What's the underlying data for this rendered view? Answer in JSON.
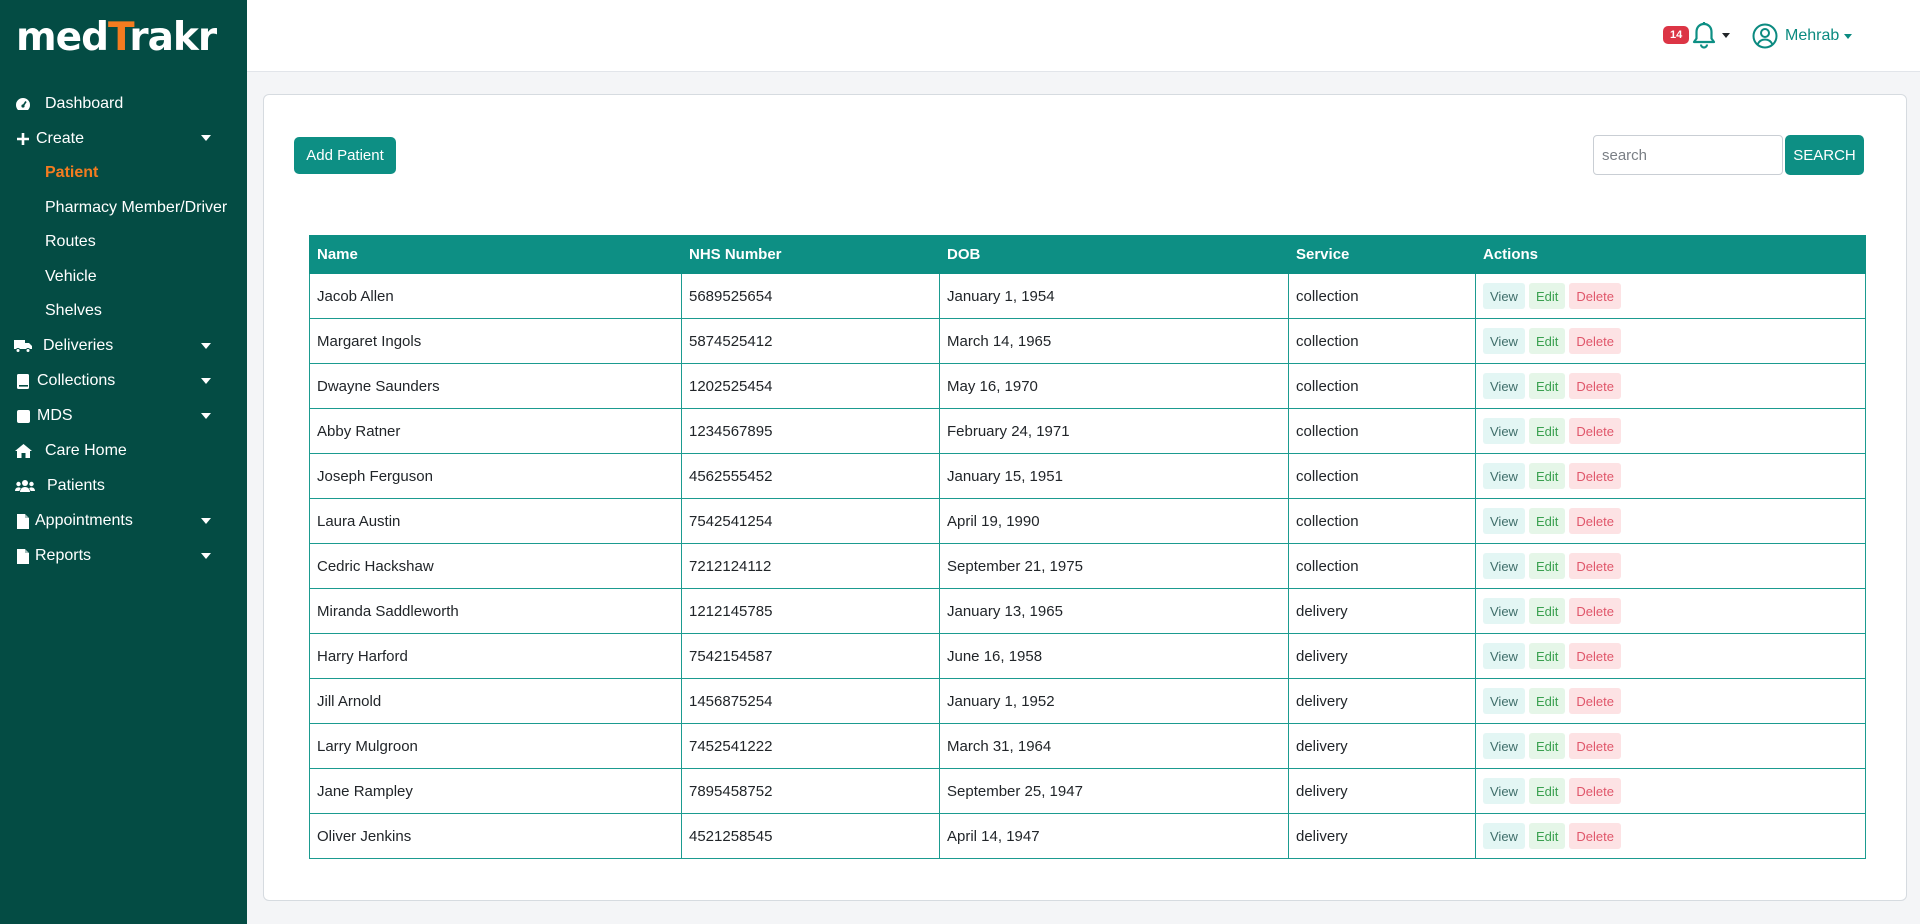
{
  "brand": {
    "logo_pre": "med",
    "logo_accent": "T",
    "logo_post": "rakr"
  },
  "sidebar": {
    "items": [
      {
        "label": "Dashboard",
        "icon": "gauge-icon"
      },
      {
        "label": "Create",
        "icon": "plus-icon",
        "expanded": true,
        "children": [
          {
            "label": "Patient",
            "active": true
          },
          {
            "label": "Pharmacy Member/Driver"
          },
          {
            "label": "Routes"
          },
          {
            "label": "Vehicle"
          },
          {
            "label": "Shelves"
          }
        ]
      },
      {
        "label": "Deliveries",
        "icon": "truck-icon"
      },
      {
        "label": "Collections",
        "icon": "book-icon"
      },
      {
        "label": "MDS",
        "icon": "square-icon"
      },
      {
        "label": "Care Home",
        "icon": "home-icon"
      },
      {
        "label": "Patients",
        "icon": "users-icon"
      },
      {
        "label": "Appointments",
        "icon": "file-icon"
      },
      {
        "label": "Reports",
        "icon": "file-icon"
      }
    ]
  },
  "header": {
    "notification_count": "14",
    "user_name": "Mehrab"
  },
  "main": {
    "add_button": "Add Patient",
    "search_placeholder": "search",
    "search_button": "SEARCH"
  },
  "table": {
    "columns": [
      "Name",
      "NHS Number",
      "DOB",
      "Service",
      "Actions"
    ],
    "action_labels": {
      "view": "View",
      "edit": "Edit",
      "delete": "Delete"
    },
    "rows": [
      [
        "Jacob Allen",
        "5689525654",
        "January 1, 1954",
        "collection"
      ],
      [
        "Margaret Ingols",
        "5874525412",
        "March 14, 1965",
        "collection"
      ],
      [
        "Dwayne Saunders",
        "1202525454",
        "May 16, 1970",
        "collection"
      ],
      [
        "Abby Ratner",
        "1234567895",
        "February 24, 1971",
        "collection"
      ],
      [
        "Joseph Ferguson",
        "4562555452",
        "January 15, 1951",
        "collection"
      ],
      [
        "Laura Austin",
        "7542541254",
        "April 19, 1990",
        "collection"
      ],
      [
        "Cedric Hackshaw",
        "7212124112",
        "September 21, 1975",
        "collection"
      ],
      [
        "Miranda Saddleworth",
        "1212145785",
        "January 13, 1965",
        "delivery"
      ],
      [
        "Harry Harford",
        "7542154587",
        "June 16, 1958",
        "delivery"
      ],
      [
        "Jill Arnold",
        "1456875254",
        "January 1, 1952",
        "delivery"
      ],
      [
        "Larry Mulgroon",
        "7452541222",
        "March 31, 1964",
        "delivery"
      ],
      [
        "Jane Rampley",
        "7895458752",
        "September 25, 1947",
        "delivery"
      ],
      [
        "Oliver Jenkins",
        "4521258545",
        "April 14, 1947",
        "delivery"
      ]
    ]
  },
  "colors": {
    "sidebar": "#044c44",
    "accent": "#f47c20",
    "teal": "#0d8f84",
    "badge": "#dc3545"
  }
}
